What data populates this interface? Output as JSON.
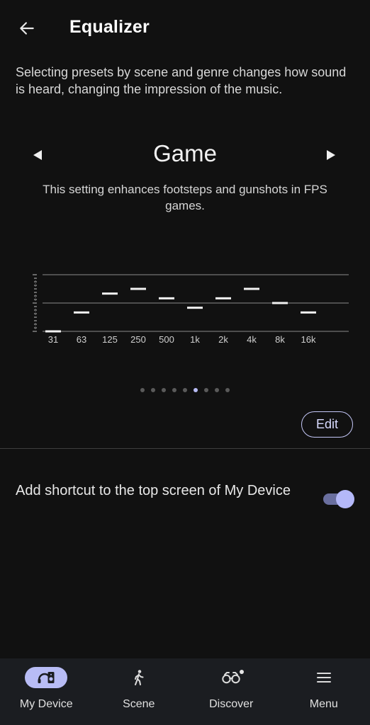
{
  "header": {
    "title": "Equalizer",
    "back_icon": "arrow-left-icon"
  },
  "description": "Selecting presets by scene and genre changes how sound is heard, changing the impression of the music.",
  "preset": {
    "name": "Game",
    "description": "This setting enhances footsteps and gunshots in FPS games.",
    "prev_icon": "triangle-left-icon",
    "next_icon": "triangle-right-icon"
  },
  "eq": {
    "bands": [
      "31",
      "63",
      "125",
      "250",
      "500",
      "1k",
      "2k",
      "4k",
      "8k",
      "16k"
    ],
    "levels": [
      -6,
      -2,
      2,
      3,
      1,
      -1,
      1,
      3,
      0,
      -2
    ],
    "range": [
      -6,
      6
    ]
  },
  "pager": {
    "count": 9,
    "active_index": 5
  },
  "edit_button": {
    "label": "Edit"
  },
  "shortcut": {
    "label": "Add shortcut to the top screen of My Device",
    "enabled": true
  },
  "nav": {
    "items": [
      {
        "label": "My Device",
        "icon": "device-icon",
        "active": true
      },
      {
        "label": "Scene",
        "icon": "walking-person-icon",
        "active": false
      },
      {
        "label": "Discover",
        "icon": "binoculars-icon",
        "active": false
      },
      {
        "label": "Menu",
        "icon": "menu-icon",
        "active": false
      }
    ]
  },
  "colors": {
    "accent": "#b8bcf5",
    "background": "#111111",
    "nav_background": "#1b1d21"
  }
}
